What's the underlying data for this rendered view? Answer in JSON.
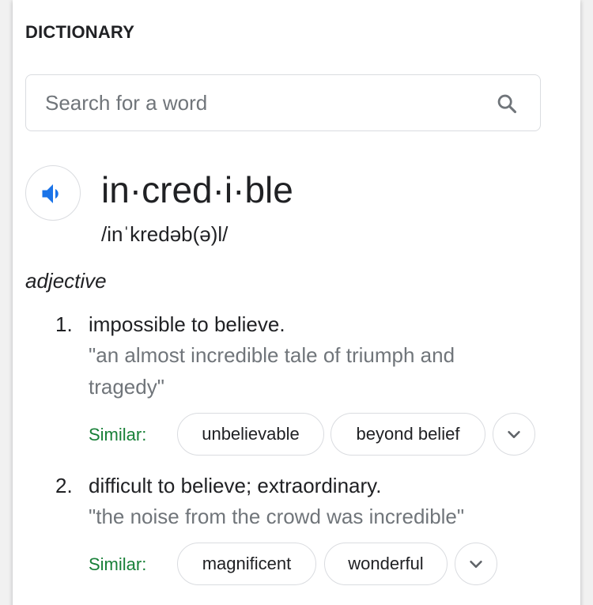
{
  "section_title": "DICTIONARY",
  "search": {
    "placeholder": "Search for a word",
    "icon": "search-icon"
  },
  "entry": {
    "headword": "in·cred·i·ble",
    "phonetic": "/inˈkredəb(ə)l/",
    "pronounce_icon": "speaker-icon",
    "part_of_speech": "adjective",
    "senses": [
      {
        "number": "1.",
        "definition": "impossible to believe.",
        "example_line1": "\"an almost incredible tale of triumph and",
        "example_line2": "tragedy\"",
        "similar_label": "Similar:",
        "similar": [
          "unbelievable",
          "beyond belief"
        ]
      },
      {
        "number": "2.",
        "definition": "difficult to believe; extraordinary.",
        "example_line1": "\"the noise from the crowd was incredible\"",
        "similar_label": "Similar:",
        "similar": [
          "magnificent",
          "wonderful"
        ]
      }
    ]
  },
  "colors": {
    "accent_blue": "#1a73e8",
    "similar_green": "#188038",
    "example_gray": "#70757a",
    "text": "#202124",
    "border": "#dadce0"
  }
}
